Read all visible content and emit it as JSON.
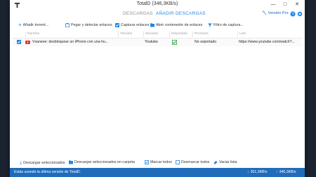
{
  "window": {
    "title": "TotalD (346,3KB/s)"
  },
  "tabs": [
    {
      "label": "DESCARGAS"
    },
    {
      "label": "AÑADIR DESCARGAS"
    }
  ],
  "header": {
    "version_pro": "Versión Pro",
    "help_icon": "help-icon",
    "settings_icon": "gear-icon"
  },
  "toolbar": {
    "add_torrent": "Añadir torrent...",
    "paste_detect": "Pegar y detectar enlaces",
    "capture_links": "Capturar enlaces",
    "open_links_container": "Abrir contenedor de enlaces",
    "capture_filter": "Filtro de captura..."
  },
  "table": {
    "columns": [
      "Nombre",
      "Tamaño",
      "Servidor",
      "Disponible",
      "Premium",
      "Link"
    ],
    "rows": [
      {
        "checked": true,
        "name": "Vsaneee: desbloquear un iPhone con una hu...",
        "size": "",
        "server": "Youtube",
        "available": true,
        "premium": "No soportado",
        "link": "https://www.youtube.com/watch?..."
      }
    ]
  },
  "bottom_actions": {
    "download_selected": "Descargar seleccionados",
    "download_selected_folder": "Descargar seleccionados en carpeta",
    "select_all": "Marcar todos",
    "deselect_all": "Desmarcar todos",
    "clear_list": "Vaciar lista"
  },
  "status": {
    "message": "Estás usando la última versión de TotalD.",
    "download_speed": "301,3KB/s",
    "upload_speed": "346,3KB/s"
  },
  "colors": {
    "accent": "#1e88e5",
    "statusbar": "#1f6cbb",
    "background": "#1b2330",
    "available_green": "#2e9d3e",
    "youtube_red": "#e52d27"
  }
}
